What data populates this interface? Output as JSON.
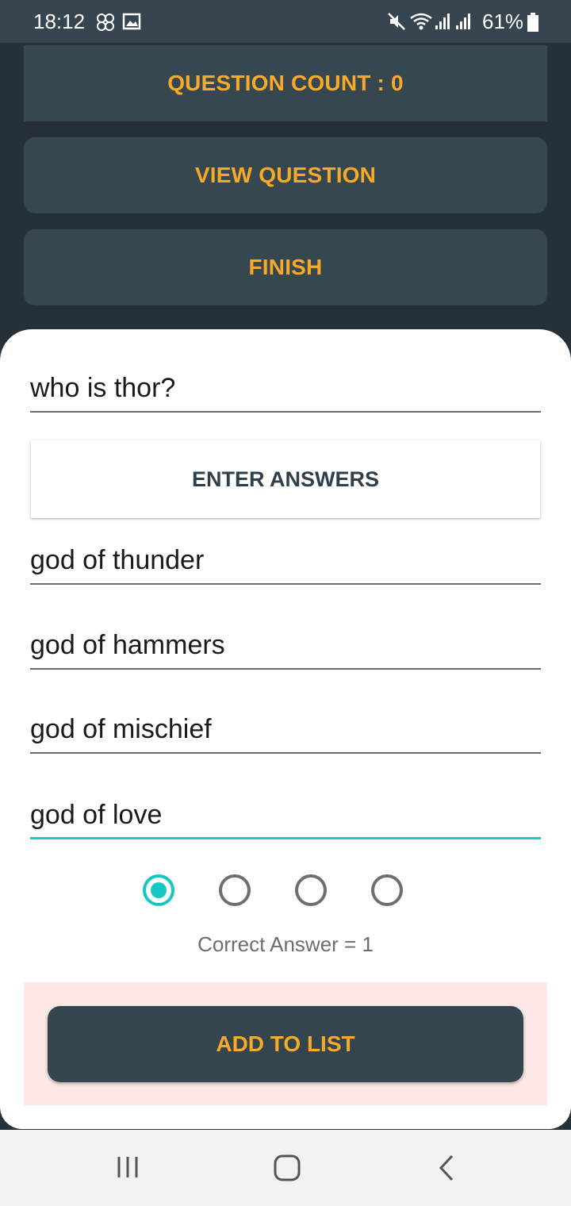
{
  "status_bar": {
    "time": "18:12",
    "battery": "61%",
    "icons": [
      "notification-icon",
      "gallery-icon",
      "mute-icon",
      "wifi-icon",
      "signal-icon",
      "signal-icon",
      "battery-icon"
    ]
  },
  "top": {
    "question_count": "QUESTION COUNT : 0",
    "view_question": "VIEW QUESTION",
    "finish": "FINISH"
  },
  "form": {
    "question": "who is thor?",
    "enter_answers": "ENTER ANSWERS",
    "answers": [
      "god of thunder",
      "god of hammers",
      "god of mischief",
      "god of love"
    ],
    "selected_option": 1,
    "correct_answer_text": "Correct Answer = 1",
    "add_to_list": "ADD TO LIST"
  },
  "colors": {
    "accent": "#f7a928",
    "teal": "#16c9c0",
    "dark": "#263038",
    "button": "#36474f",
    "highlight": "#fce8e6"
  },
  "nav_bar": {
    "icons": [
      "recent-apps-icon",
      "home-icon",
      "back-icon"
    ]
  }
}
